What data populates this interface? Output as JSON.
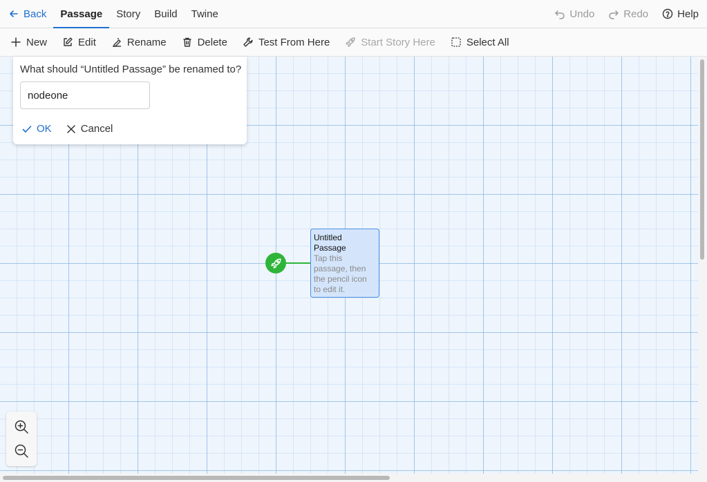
{
  "topbar": {
    "back_label": "Back",
    "tabs": [
      {
        "label": "Passage",
        "active": true
      },
      {
        "label": "Story"
      },
      {
        "label": "Build"
      },
      {
        "label": "Twine"
      }
    ],
    "undo_label": "Undo",
    "redo_label": "Redo",
    "help_label": "Help"
  },
  "toolbar": {
    "new_label": "New",
    "edit_label": "Edit",
    "rename_label": "Rename",
    "delete_label": "Delete",
    "test_label": "Test From Here",
    "start_label": "Start Story Here",
    "select_all_label": "Select All"
  },
  "dialog": {
    "prompt": "What should “Untitled Passage” be renamed to?",
    "value": "nodeone",
    "ok_label": "OK",
    "cancel_label": "Cancel"
  },
  "passage": {
    "title": "Untitled Passage",
    "excerpt": "Tap this passage, then the pencil icon to edit it."
  },
  "colors": {
    "accent": "#1f6fd1",
    "start_green": "#2fb43a",
    "passage_fill": "#d4e5fb",
    "grid_bg": "#eef5fd"
  },
  "icons": {
    "back": "arrow-left-icon",
    "undo": "undo-icon",
    "redo": "redo-icon",
    "help": "help-circle-icon",
    "new": "plus-icon",
    "edit": "edit-icon",
    "rename": "rename-icon",
    "delete": "trash-icon",
    "test": "tool-icon",
    "start": "rocket-icon",
    "select_all": "marquee-icon",
    "ok": "check-icon",
    "cancel": "x-icon",
    "zoom_in": "zoom-in-icon",
    "zoom_out": "zoom-out-icon"
  }
}
